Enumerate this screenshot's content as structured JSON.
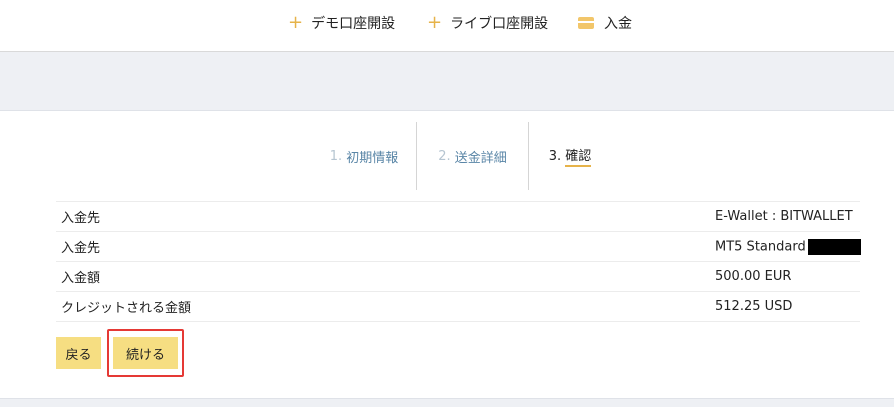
{
  "nav": {
    "items": [
      {
        "label": "デモ口座開設",
        "icon": "plus-icon"
      },
      {
        "label": "ライブ口座開設",
        "icon": "plus-icon"
      },
      {
        "label": "入金",
        "icon": "card-icon"
      }
    ]
  },
  "steps": [
    {
      "num": "1.",
      "label": "初期情報",
      "active": false
    },
    {
      "num": "2.",
      "label": "送金詳細",
      "active": false
    },
    {
      "num": "3.",
      "label": "確認",
      "active": true
    }
  ],
  "summary": {
    "rows": [
      {
        "key": "入金先",
        "value": "E-Wallet : BITWALLET"
      },
      {
        "key": "入金先",
        "value": "MT5 Standard"
      },
      {
        "key": "入金額",
        "value": "500.00 EUR"
      },
      {
        "key": "クレジットされる金額",
        "value": "512.25 USD"
      }
    ]
  },
  "buttons": {
    "back": "戻る",
    "continue": "続ける"
  },
  "colors": {
    "accent": "#e6b34a",
    "button": "#f6de82",
    "highlight": "#e53935",
    "band": "#eef0f4"
  }
}
